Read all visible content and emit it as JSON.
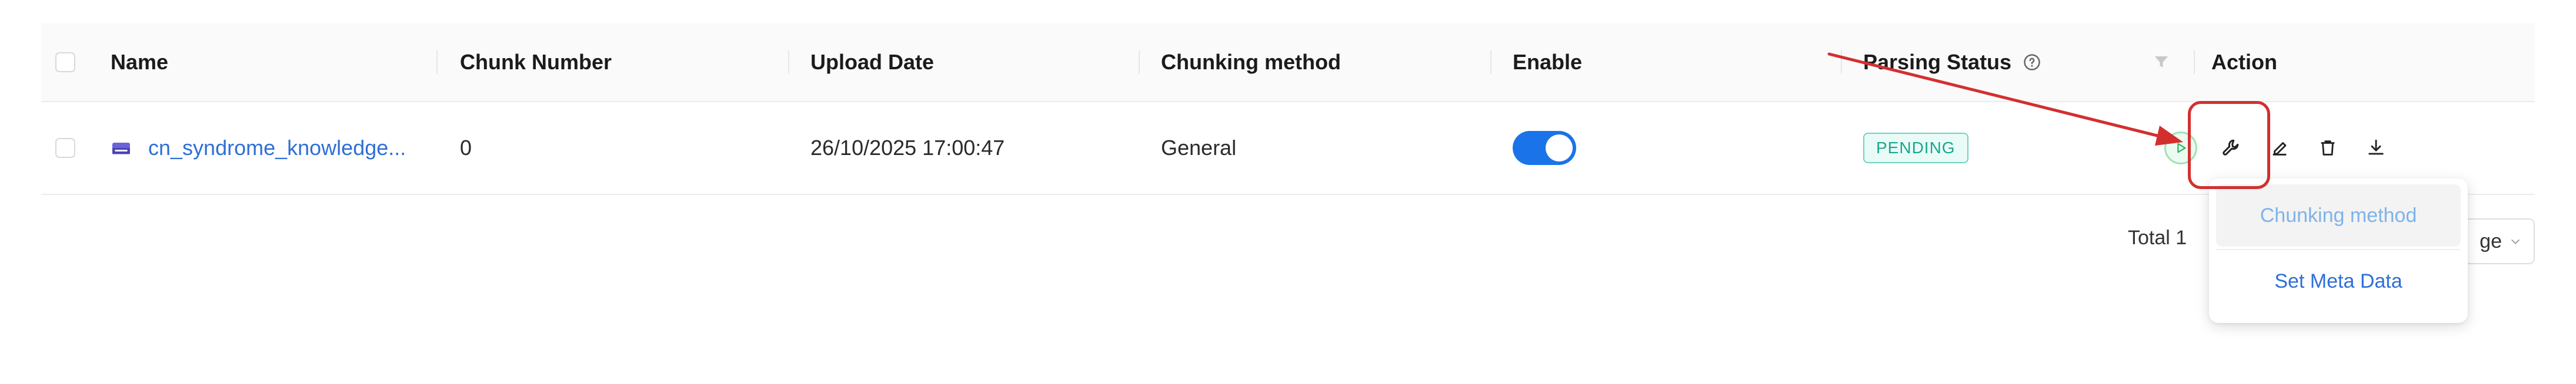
{
  "table": {
    "columns": {
      "name": "Name",
      "chunk_number": "Chunk Number",
      "upload_date": "Upload Date",
      "chunking_method": "Chunking method",
      "enable": "Enable",
      "parsing_status": "Parsing Status",
      "action": "Action"
    },
    "rows": [
      {
        "name": "cn_syndrome_knowledge...",
        "chunk_number": "0",
        "upload_date": "26/10/2025 17:00:47",
        "chunking_method": "General",
        "enabled": true,
        "status": "PENDING"
      }
    ]
  },
  "pagination": {
    "total": "Total 1",
    "page_size_suffix": "ge"
  },
  "dropdown": {
    "items": [
      "Chunking method",
      "Set Meta Data"
    ]
  },
  "colors": {
    "accent": "#1a73e8",
    "link": "#2f6fd6",
    "annotation": "#d32f2f",
    "status_pending": "#1aa68f"
  },
  "icons": [
    "file-icon",
    "help-circle-icon",
    "filter-icon",
    "play-icon",
    "wrench-icon",
    "edit-icon",
    "trash-icon",
    "download-icon",
    "chevron-down-icon"
  ]
}
